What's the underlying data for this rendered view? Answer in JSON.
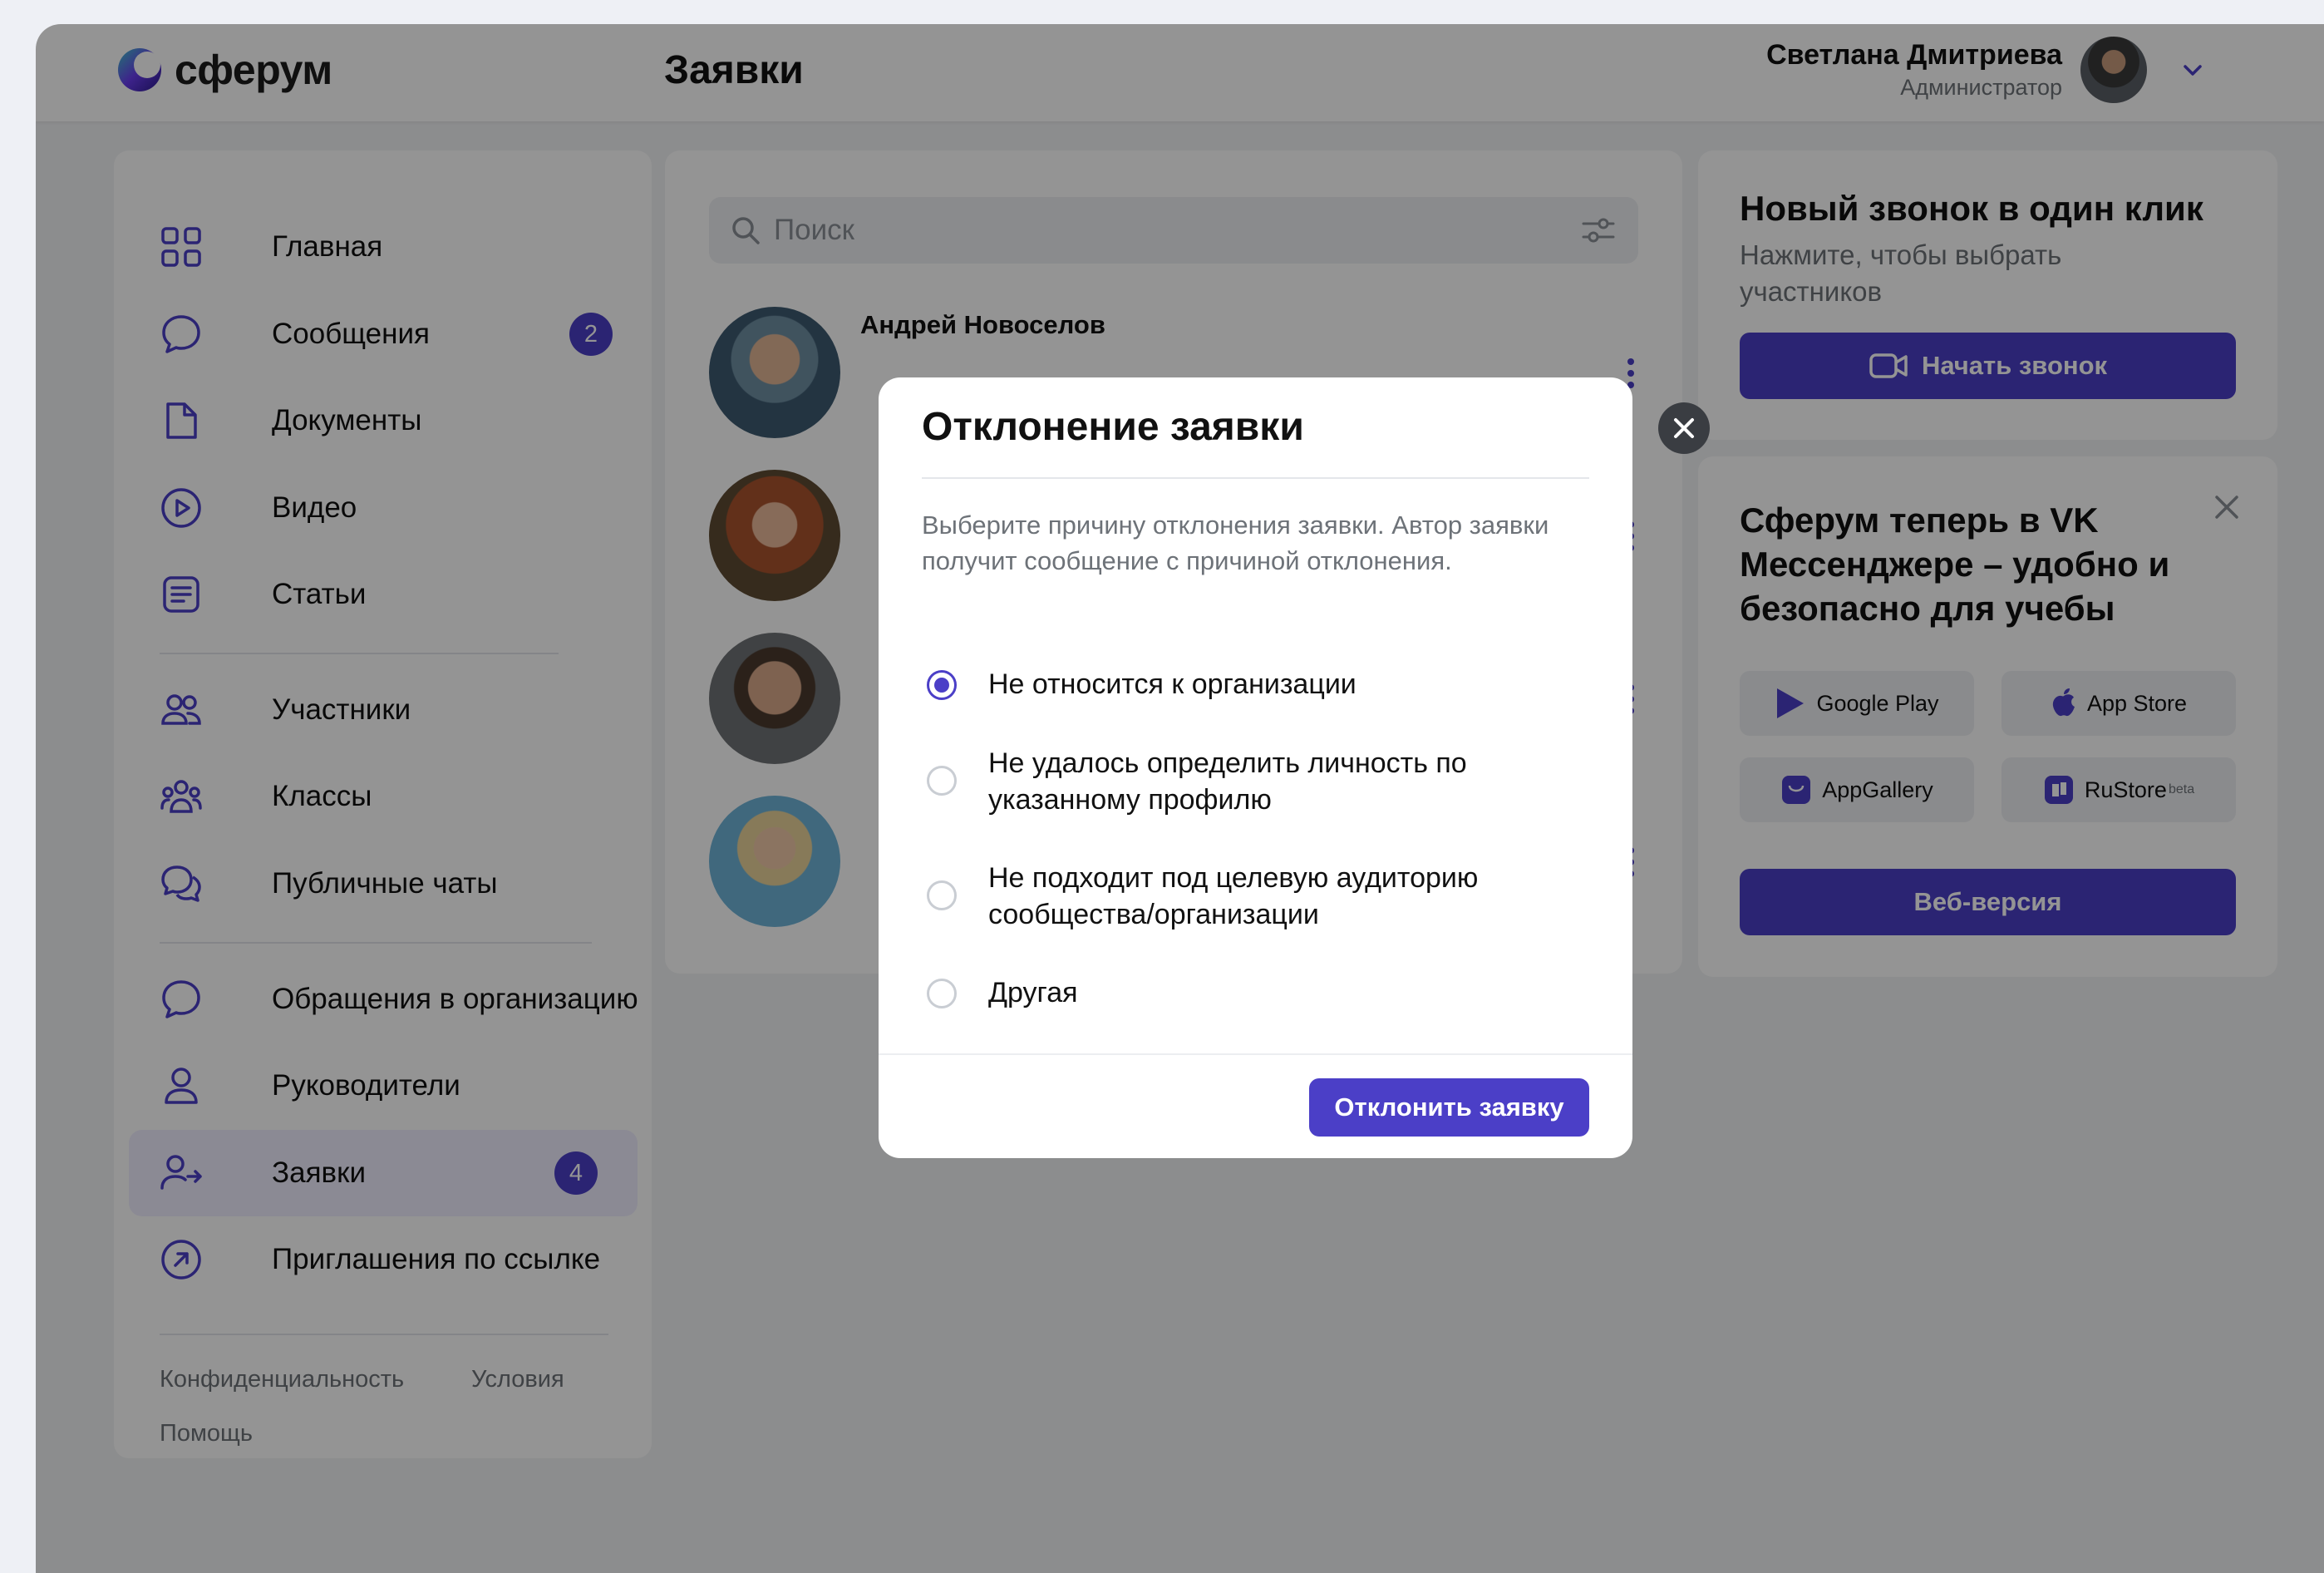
{
  "app": {
    "logo_text": "сферум"
  },
  "header": {
    "title": "Заявки",
    "user_name": "Светлана Дмитриева",
    "user_role": "Администратор"
  },
  "sidebar": {
    "items": [
      {
        "label": "Главная",
        "icon": "grid-icon"
      },
      {
        "label": "Сообщения",
        "icon": "message-icon",
        "badge": "2"
      },
      {
        "label": "Документы",
        "icon": "document-icon"
      },
      {
        "label": "Видео",
        "icon": "play-icon"
      },
      {
        "label": "Статьи",
        "icon": "article-icon"
      },
      {
        "label": "Участники",
        "icon": "users-icon"
      },
      {
        "label": "Классы",
        "icon": "groups-icon"
      },
      {
        "label": "Публичные чаты",
        "icon": "chats-icon"
      },
      {
        "label": "Обращения в организацию",
        "icon": "message-icon"
      },
      {
        "label": "Руководители",
        "icon": "user-icon"
      },
      {
        "label": "Заявки",
        "icon": "user-arrow-icon",
        "badge": "4",
        "active": true
      },
      {
        "label": "Приглашения по ссылке",
        "icon": "link-arrow-icon"
      }
    ],
    "footer": {
      "privacy": "Конфиденциальность",
      "terms": "Условия",
      "help": "Помощь"
    }
  },
  "requests": {
    "search_placeholder": "Поиск",
    "people": [
      {
        "name": "Андрей Новоселов"
      },
      {
        "name": ""
      },
      {
        "name": ""
      },
      {
        "name": ""
      }
    ]
  },
  "call_card": {
    "title": "Новый звонок в один клик",
    "subtitle": "Нажмите, чтобы выбрать участников",
    "button": "Начать звонок"
  },
  "promo_card": {
    "title": "Сферум теперь в VK Мессенджере – удобно и безопасно для учебы",
    "stores": [
      "Google Play",
      "App Store",
      "AppGallery",
      "RuStore"
    ],
    "rustore_badge": "beta",
    "web_button": "Веб-версия"
  },
  "modal": {
    "title": "Отклонение заявки",
    "description": "Выберите причину отклонения заявки. Автор заявки получит сообщение с причиной отклонения.",
    "options": [
      {
        "label": "Не относится к организации",
        "checked": true
      },
      {
        "label": "Не удалось определить личность по указанному профилю",
        "checked": false
      },
      {
        "label": "Не подходит под целевую аудиторию сообщества/организации",
        "checked": false
      },
      {
        "label": "Другая",
        "checked": false
      }
    ],
    "submit": "Отклонить заявку"
  },
  "colors": {
    "accent": "#4b3fc7",
    "overlay": "rgba(0,0,0,0.42)"
  }
}
